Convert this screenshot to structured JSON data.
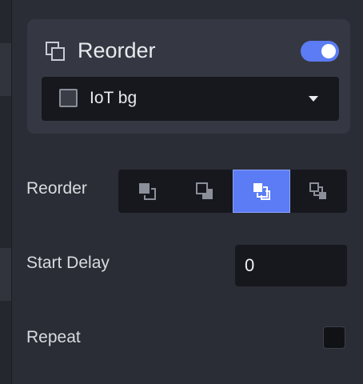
{
  "card": {
    "icon": "layers-icon",
    "title": "Reorder",
    "enabled": true,
    "dropdown": {
      "swatch_icon": "square-swatch-icon",
      "value": "IoT bg"
    }
  },
  "reorder_row": {
    "label": "Reorder",
    "options": [
      {
        "icon": "bring-forward-icon"
      },
      {
        "icon": "send-backward-icon"
      },
      {
        "icon": "bring-to-front-icon",
        "active": true
      },
      {
        "icon": "send-to-back-icon"
      }
    ]
  },
  "start_delay": {
    "label": "Start Delay",
    "value": "0"
  },
  "repeat": {
    "label": "Repeat",
    "checked": false
  },
  "colors": {
    "accent": "#5b7cf5",
    "panel": "#2a2d35",
    "card": "#353842",
    "field": "#16181d"
  }
}
